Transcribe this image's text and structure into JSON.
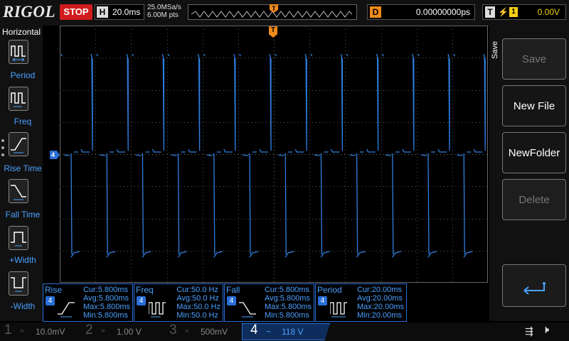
{
  "brand": "RIGOL",
  "run_state": "STOP",
  "timebase": {
    "key": "H",
    "value": "20.0ms"
  },
  "acquisition": {
    "sample_rate": "25.0MSa/s",
    "memory_depth": "6.00M pts"
  },
  "trigger_position_label": "T",
  "delay": {
    "key": "D",
    "value": "0.00000000ps"
  },
  "trigger": {
    "key": "T",
    "edge": "⚡",
    "source": "1",
    "level": "0.00V"
  },
  "left_menu": {
    "title": "Horizontal",
    "items": [
      {
        "label": "Period",
        "icon": "period-icon"
      },
      {
        "label": "Freq",
        "icon": "freq-icon"
      },
      {
        "label": "Rise Time",
        "icon": "rise-time-icon"
      },
      {
        "label": "Fall Time",
        "icon": "fall-time-icon"
      },
      {
        "label": "+Width",
        "icon": "positive-width-icon"
      },
      {
        "label": "-Width",
        "icon": "negative-width-icon"
      }
    ]
  },
  "channel_marker": "4",
  "trigger_level_marker": "T",
  "right_menu": {
    "tab": "Save",
    "buttons": [
      {
        "label": "Save",
        "enabled": false
      },
      {
        "label": "New File",
        "enabled": true
      },
      {
        "label": "NewFolder",
        "enabled": true
      },
      {
        "label": "Delete",
        "enabled": false
      }
    ],
    "enter_icon": "enter-arrow-icon"
  },
  "measurements": [
    {
      "name": "Rise",
      "channel": "4",
      "cur": "Cur:5.800ms",
      "avg": "Avg:5.800ms",
      "max": "Max:5.800ms",
      "min": "Min:5.800ms"
    },
    {
      "name": "Freq",
      "channel": "4",
      "cur": "Cur:50.0 Hz",
      "avg": "Avg:50.0 Hz",
      "max": "Max:50.0 Hz",
      "min": "Min:50.0 Hz"
    },
    {
      "name": "Fall",
      "channel": "4",
      "cur": "Cur:5.800ms",
      "avg": "Avg:5.800ms",
      "max": "Max:5.800ms",
      "min": "Min:5.800ms"
    },
    {
      "name": "Period",
      "channel": "4",
      "cur": "Cur:20.00ms",
      "avg": "Avg:20.00ms",
      "max": "Max:20.00ms",
      "min": "Min:20.00ms"
    }
  ],
  "channels": [
    {
      "num": "1",
      "coupling": "=",
      "scale": "10.0mV",
      "color": "#c8c800",
      "active": false
    },
    {
      "num": "2",
      "coupling": "=",
      "scale": "1.00 V",
      "color": "#00c8c8",
      "active": false
    },
    {
      "num": "3",
      "coupling": "=",
      "scale": "500mV",
      "color": "#c800c8",
      "active": false
    },
    {
      "num": "4",
      "coupling": "~",
      "scale": "118 V",
      "color": "#2a6fd8",
      "active": true
    }
  ],
  "colors": {
    "trace": "#2f7fe0",
    "accent": "#f08a1c",
    "stop": "#d01c1c",
    "trigger": "#f5d016"
  }
}
